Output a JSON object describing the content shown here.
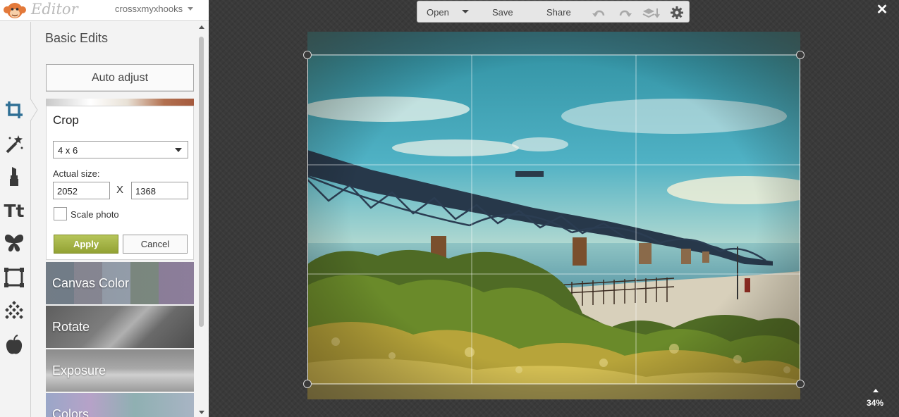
{
  "app": {
    "name": "Editor",
    "username": "crossxmyxhooks",
    "logo_icon": "monkey-logo-icon"
  },
  "tools": [
    {
      "name": "crop-tool-icon",
      "active": true
    },
    {
      "name": "magic-wand-icon"
    },
    {
      "name": "lipstick-icon"
    },
    {
      "name": "text-icon",
      "label": "Tt"
    },
    {
      "name": "butterfly-icon"
    },
    {
      "name": "frame-icon"
    },
    {
      "name": "texture-icon"
    },
    {
      "name": "apple-icon"
    }
  ],
  "panel": {
    "title": "Basic Edits",
    "auto_adjust": "Auto adjust"
  },
  "crop": {
    "title": "Crop",
    "ratio": "4 x 6",
    "actual_size_label": "Actual size:",
    "width": "2052",
    "separator": "X",
    "height": "1368",
    "scale_label": "Scale photo",
    "scale_checked": false,
    "apply": "Apply",
    "cancel": "Cancel"
  },
  "tiles": [
    {
      "label": "Canvas Color"
    },
    {
      "label": "Rotate"
    },
    {
      "label": "Exposure"
    },
    {
      "label": "Colors"
    }
  ],
  "toolbar": {
    "open": "Open",
    "save": "Save",
    "share": "Share",
    "icons": [
      "undo-icon",
      "redo-icon",
      "layers-icon",
      "settings-gear-icon"
    ]
  },
  "zoom": {
    "level": "34%"
  },
  "colors": {
    "apply_green": "#a3b244",
    "workspace": "#3b3b3b",
    "panel": "#f3f3f3"
  }
}
